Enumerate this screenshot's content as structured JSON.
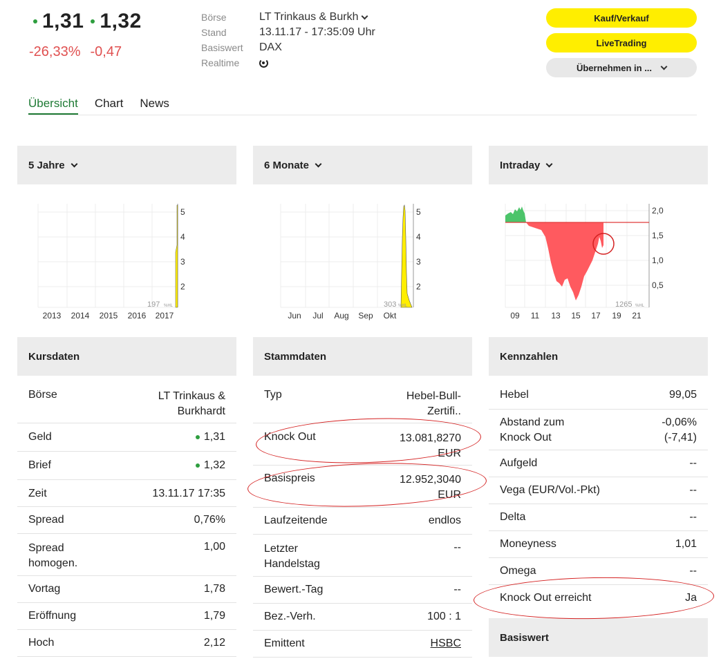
{
  "quote": {
    "bid": "1,31",
    "ask": "1,32",
    "change_pct": "-26,33%",
    "change_abs": "-0,47",
    "up_color": "#2e9e3f",
    "down_color": "#e05050"
  },
  "meta": {
    "boerse_label": "Börse",
    "boerse_value": "LT Trinkaus & Burkh",
    "stand_label": "Stand",
    "stand_value": "13.11.17 - 17:35:09 Uhr",
    "basiswert_label": "Basiswert",
    "basiswert_value": "DAX",
    "realtime_label": "Realtime",
    "realtime_icon": "refresh-icon"
  },
  "buttons": {
    "kauf": "Kauf/Verkauf",
    "live": "LiveTrading",
    "uebernehmen": "Übernehmen in ..."
  },
  "tabs": [
    "Übersicht",
    "Chart",
    "News"
  ],
  "charts": {
    "five_years": {
      "title": "5 Jahre",
      "x_labels": [
        "2013",
        "2014",
        "2015",
        "2016",
        "2017"
      ],
      "y_labels": [
        "5",
        "4",
        "3",
        "2"
      ],
      "watermark": "197",
      "watermark_suffix": "%HL"
    },
    "six_months": {
      "title": "6 Monate",
      "x_labels": [
        "Jun",
        "Jul",
        "Aug",
        "Sep",
        "Okt"
      ],
      "y_labels": [
        "5",
        "4",
        "3",
        "2"
      ],
      "watermark": "303",
      "watermark_suffix": "%HL"
    },
    "intraday": {
      "title": "Intraday",
      "x_labels": [
        "09",
        "11",
        "13",
        "15",
        "17",
        "19",
        "21"
      ],
      "y_labels": [
        "2,0",
        "1,5",
        "1,0",
        "0,5"
      ],
      "watermark": "1265",
      "watermark_suffix": "%HL",
      "up_color": "#4cc46a",
      "down_color": "#ff5a5f"
    }
  },
  "kursdaten": {
    "title": "Kursdaten",
    "rows": [
      {
        "label": "Börse",
        "value": "LT Trinkaus & Burkhardt"
      },
      {
        "label": "Geld",
        "value": "1,31"
      },
      {
        "label": "Brief",
        "value": "1,32"
      },
      {
        "label": "Zeit",
        "value": "13.11.17 17:35"
      },
      {
        "label": "Spread",
        "value": "0,76%"
      },
      {
        "label": "Spread homogen.",
        "value": "1,00"
      },
      {
        "label": "Vortag",
        "value": "1,78"
      },
      {
        "label": "Eröffnung",
        "value": "1,79"
      },
      {
        "label": "Hoch",
        "value": "2,12"
      }
    ]
  },
  "stammdaten": {
    "title": "Stammdaten",
    "rows": [
      {
        "label": "Typ",
        "value": "Hebel-Bull-Zertifi.."
      },
      {
        "label": "Knock Out",
        "value": "13.081,8270 EUR"
      },
      {
        "label": "Basispreis",
        "value": "12.952,3040 EUR"
      },
      {
        "label": "Laufzeitende",
        "value": "endlos"
      },
      {
        "label": "Letzter Handelstag",
        "value": "--"
      },
      {
        "label": "Bewert.-Tag",
        "value": "--"
      },
      {
        "label": "Bez.-Verh.",
        "value": "100 : 1"
      },
      {
        "label": "Emittent",
        "value": "HSBC"
      }
    ]
  },
  "kennzahlen": {
    "title": "Kennzahlen",
    "rows": [
      {
        "label": "Hebel",
        "value": "99,05"
      },
      {
        "label": "Abstand zum Knock Out",
        "value": "-0,06% (-7,41)"
      },
      {
        "label": "Aufgeld",
        "value": "--"
      },
      {
        "label": "Vega (EUR/Vol.-Pkt)",
        "value": "--"
      },
      {
        "label": "Delta",
        "value": "--"
      },
      {
        "label": "Moneyness",
        "value": "1,01"
      },
      {
        "label": "Omega",
        "value": "--"
      },
      {
        "label": "Knock Out erreicht",
        "value": "Ja"
      }
    ]
  },
  "basiswert_section": {
    "title": "Basiswert"
  }
}
